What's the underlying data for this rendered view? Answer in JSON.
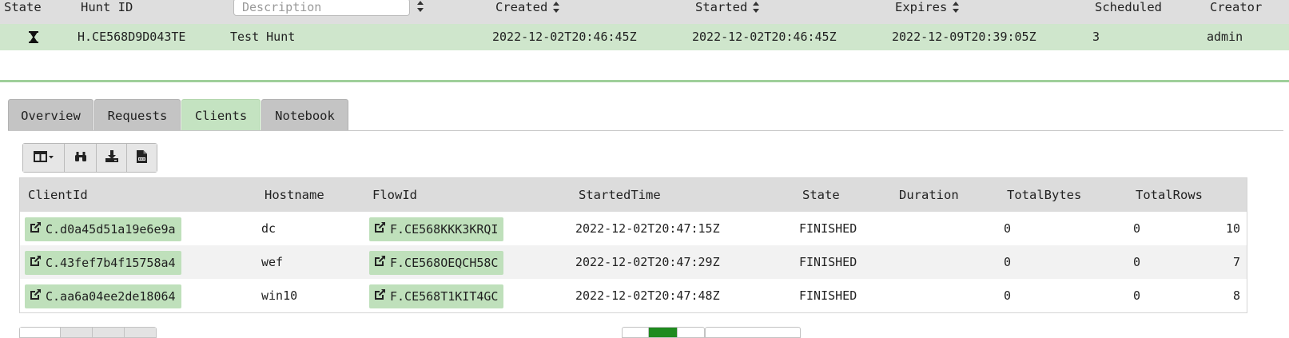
{
  "hunt_table": {
    "headers": {
      "state": "State",
      "hunt_id": "Hunt ID",
      "description_placeholder": "Description",
      "created": "Created",
      "started": "Started",
      "expires": "Expires",
      "scheduled": "Scheduled",
      "creator": "Creator"
    },
    "row": {
      "state_icon": "hourglass-icon",
      "hunt_id": "H.CE568D9D043TE",
      "description": "Test Hunt",
      "created": "2022-12-02T20:46:45Z",
      "started": "2022-12-02T20:46:45Z",
      "expires": "2022-12-09T20:39:05Z",
      "scheduled": "3",
      "creator": "admin"
    }
  },
  "tabs": [
    {
      "label": "Overview",
      "active": false
    },
    {
      "label": "Requests",
      "active": false
    },
    {
      "label": "Clients",
      "active": true
    },
    {
      "label": "Notebook",
      "active": false
    }
  ],
  "toolbar": {
    "buttons": [
      "column-selector-icon",
      "binoculars-icon",
      "download-icon",
      "csv-file-icon"
    ]
  },
  "clients_table": {
    "headers": [
      "ClientId",
      "Hostname",
      "FlowId",
      "StartedTime",
      "State",
      "Duration",
      "TotalBytes",
      "TotalRows"
    ],
    "rows": [
      {
        "client_id": "C.d0a45d51a19e6e9a",
        "hostname": "dc",
        "flow_id": "F.CE568KKK3KRQI",
        "started_time": "2022-12-02T20:47:15Z",
        "state": "FINISHED",
        "duration": "0",
        "total_bytes": "0",
        "total_rows": "10"
      },
      {
        "client_id": "C.43fef7b4f15758a4",
        "hostname": "wef",
        "flow_id": "F.CE568OEQCH58C",
        "started_time": "2022-12-02T20:47:29Z",
        "state": "FINISHED",
        "duration": "0",
        "total_bytes": "0",
        "total_rows": "7"
      },
      {
        "client_id": "C.aa6a04ee2de18064",
        "hostname": "win10",
        "flow_id": "F.CE568T1KIT4GC",
        "started_time": "2022-12-02T20:47:48Z",
        "state": "FINISHED",
        "duration": "0",
        "total_bytes": "0",
        "total_rows": "8"
      }
    ]
  },
  "colors": {
    "selected_row": "#cfe6cc",
    "active_tab": "#c4e3c1",
    "link_pill": "#bfe0bb",
    "splitter": "#9fcf9a",
    "page_active": "#1f8b1f"
  }
}
